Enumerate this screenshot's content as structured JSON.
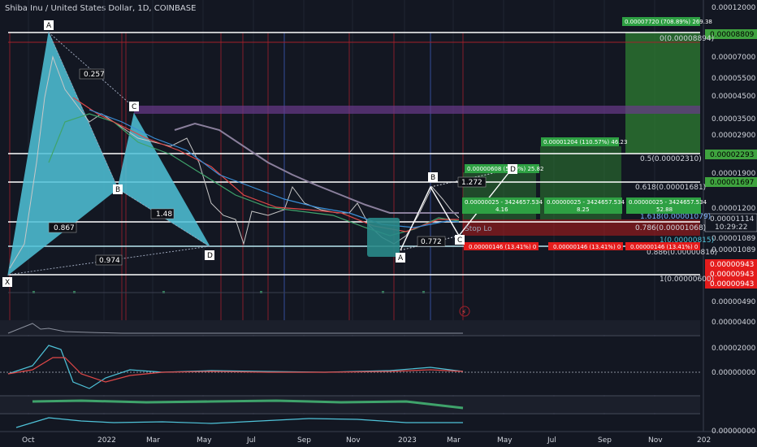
{
  "chart_title": "Shiba Inu / United States Dollar, 1D, COINBASE",
  "price_axis": {
    "ticks": [
      "0.00012000",
      "0.00008809",
      "0.00007000",
      "0.00005500",
      "0.00004500",
      "0.00003500",
      "0.00002900",
      "0.00002293",
      "0.00001900",
      "0.00001697",
      "0.00001200",
      "0.00001114",
      "10:29:22",
      "0.00001089",
      "0.00001089",
      "0.00000943",
      "0.00000943",
      "0.00000943",
      "0.00000600",
      "0.00000490",
      "0.00000400",
      "0.00002000",
      "0.00000000",
      "0.00000000"
    ],
    "highlight_top": "0.00008809",
    "highlight_mid": "0.00002293",
    "highlight_618": "0.00001697",
    "current_price": "0.00001114",
    "countdown": "10:29:22",
    "red_labels": [
      "0.00000943",
      "0.00000943",
      "0.00000943"
    ]
  },
  "time_axis": [
    "Oct",
    "2022",
    "Mar",
    "May",
    "Jul",
    "Sep",
    "Nov",
    "2023",
    "Mar",
    "May",
    "Jul",
    "Sep",
    "Nov",
    "202"
  ],
  "pattern_points": {
    "A": "A",
    "B": "B",
    "C": "C",
    "D": "D",
    "X": "X",
    "A2": "A",
    "B2": "B",
    "C2": "C",
    "D2": "D"
  },
  "ratios": [
    "0.257",
    "0.867",
    "1.48",
    "0.974",
    "1.272",
    "0.772"
  ],
  "fib_levels": [
    "0(0.00008894)",
    "0.5(0.00002310)",
    "0.618(0.00001681)",
    "1.618(0.00001079)",
    "0.786(0.00001068)",
    "1(0.00000600)",
    "1(0.00000815)",
    "0.886(0.00000816)"
  ],
  "trade_boxes": {
    "top_green": "0.00007720 (708.89%) 269.38",
    "mid_green": "0.00001204 (110.57%) 46.23",
    "small_green": "0.00000608 (55.0%) 25.82",
    "row_a": [
      "0.00000025 - 3424657.534",
      "4.16"
    ],
    "row_b": [
      "0.00000025 - 3424657.534",
      "8.25"
    ],
    "row_c": [
      "0.00000025 - 3424657.534",
      "52.88"
    ],
    "red_stop": "0.00000146 (13.41%) 0",
    "stop_label": "Stop Lo"
  },
  "colors": {
    "background": "#131722",
    "pattern_fill": "#4fc3d9",
    "green_zone": "#2e7d32",
    "red_zone": "#b71c1c",
    "purple_band": "#6a3b8a"
  }
}
